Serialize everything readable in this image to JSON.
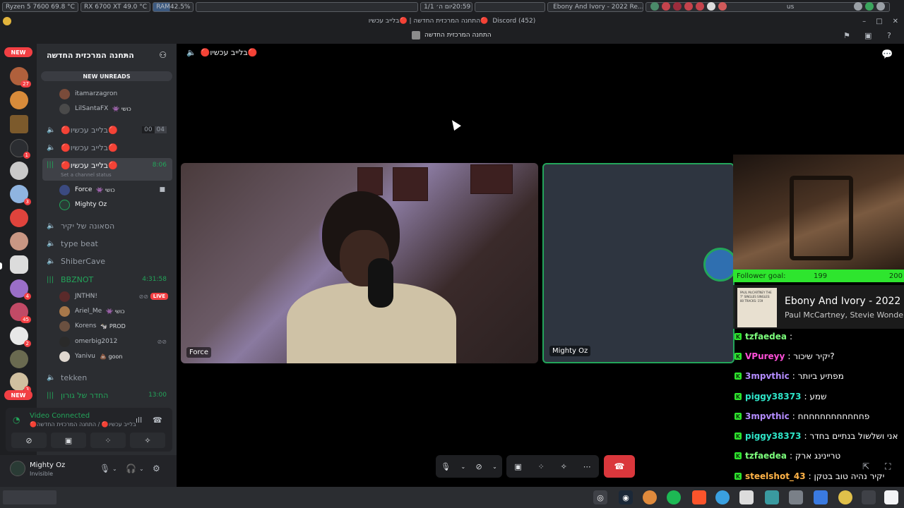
{
  "system_bar": {
    "cpu": "Ryzen 5 7600  69.8 °C",
    "gpu": "RX 6700 XT  49.0 °C",
    "ram_label": "RAM",
    "ram_value": "42.5%",
    "clock": "20:59",
    "date": "יום ה׳ 1/1",
    "media_title": "Ebony And Ivory - 2022 Re...",
    "locale": "us"
  },
  "window": {
    "title": "Discord (452)",
    "breadcrumb": "התחנה המרכזית החדשה | 🔴בלייב עכשיו🔴",
    "channel_header": "התחנה המרכזית החדשה"
  },
  "rail": {
    "new_top": "NEW",
    "new_bottom": "NEW",
    "badges": [
      "27",
      "1",
      "3",
      "4",
      "45",
      "2",
      "3"
    ]
  },
  "guild": {
    "name": "התחנה המרכזית החדשה",
    "new_unreads": "NEW UNREADS"
  },
  "channels": [
    {
      "name": "🔴בלייב עכשיו🔴",
      "counter_a": "00",
      "counter_b": "04"
    },
    {
      "name": "🔴בלייב עכשיו🔴"
    },
    {
      "name": "🔴בלייב עכשיו🔴",
      "status_hint": "Set a channel status",
      "time": "8:06"
    },
    {
      "name": "הסאונה של יקיר"
    },
    {
      "name": "type beat"
    },
    {
      "name": "ShiberCave"
    },
    {
      "name": "BBZNOT",
      "time": "4:31:58"
    },
    {
      "name": "tekken"
    },
    {
      "name": "החדר של גורון",
      "time": "13:00"
    }
  ],
  "top_users": [
    {
      "name": "itamarzagron"
    },
    {
      "name": "LilSantaFX",
      "tag": "👾 כושי"
    }
  ],
  "active_users": [
    {
      "name": "Force",
      "tag": "👾 כושי"
    },
    {
      "name": "Mighty Oz"
    }
  ],
  "bbznot_users": [
    {
      "name": "JNTHN!",
      "live": "LIVE"
    },
    {
      "name": "Ariel_Me",
      "tag": "👾 כושי"
    },
    {
      "name": "Korens",
      "tag": "🐄 PROD"
    },
    {
      "name": "omerbig2012"
    },
    {
      "name": "Yanivu",
      "tag": "💩 goon"
    }
  ],
  "voice": {
    "status": "Video Connected",
    "subtitle": "🔴בלייב עכשיו🔴 / התחנה המרכזית החדשה"
  },
  "user": {
    "name": "Mighty Oz",
    "status": "Invisible"
  },
  "main": {
    "channel_title": "🔴בלייב עכשיו🔴"
  },
  "tiles": [
    {
      "label": "Force"
    },
    {
      "label": "Mighty Oz"
    }
  ],
  "overlay": {
    "goal_label": "Follower goal:",
    "goal_current": "199",
    "goal_target": "200",
    "goal_progress": 0.995,
    "album_text": "PAUL McCARTNEY THE 7\" SINGLES SINGLES: 80 TRACKS: 159",
    "song_title": "Ebony And Ivory - 2022",
    "song_artist": "Paul McCartney, Stevie Wonder"
  },
  "chat": [
    {
      "user": "tzfaedea",
      "msg": ":",
      "color": "#7cff7c"
    },
    {
      "user": "VPureyy",
      "msg": ": יקיר שיכור?",
      "color": "#ff4fd8"
    },
    {
      "user": "3mpvthic",
      "msg": ": מפתיע ביותר",
      "color": "#b48cff"
    },
    {
      "user": "piggy38373",
      "msg": ": שמע",
      "color": "#2ee5c8"
    },
    {
      "user": "3mpvthic",
      "msg": ": פחחחחחחחחחחחח",
      "color": "#b48cff"
    },
    {
      "user": "piggy38373",
      "msg": ": אני ושלשול בנתיים בחדר",
      "color": "#2ee5c8"
    },
    {
      "user": "tzfaedea",
      "msg": ": טריינינג ארק",
      "color": "#7cff7c"
    },
    {
      "user": "steelshot_43",
      "msg": ": יקיר נהיה טוב בטקן",
      "color": "#ffb347"
    }
  ],
  "colors": {
    "accent_green": "#23a55a",
    "danger_red": "#da373c",
    "goal_green": "#2ee52e"
  }
}
